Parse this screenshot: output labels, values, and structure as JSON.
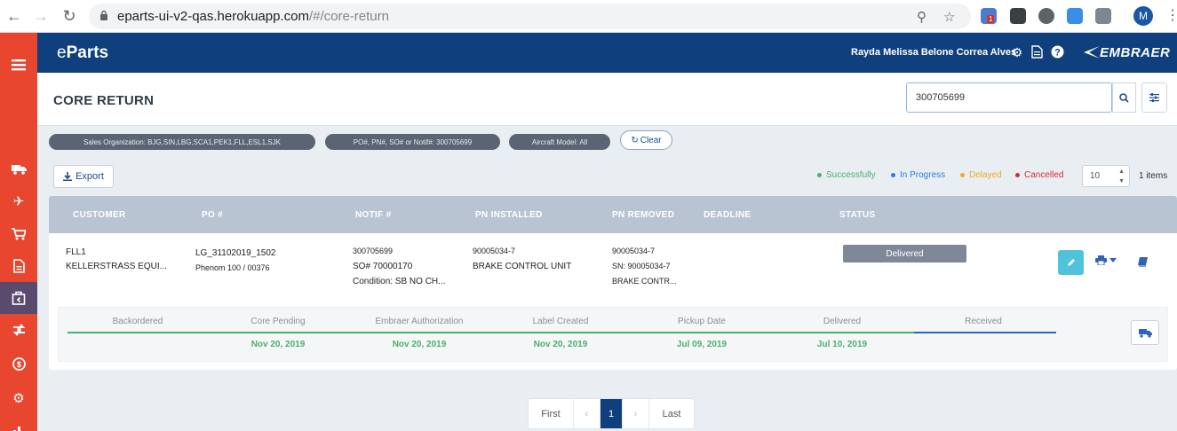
{
  "browser": {
    "url_host": "eparts-ui-v2-qas.herokuapp.com",
    "url_path": "/#/core-return",
    "profile_initial": "M",
    "ext_badge": "1"
  },
  "header": {
    "logo_e": "e",
    "logo_rest": "Parts",
    "user_name": "Rayda Melissa Belone Correa Alves",
    "brand": "EMBRAER"
  },
  "page": {
    "title": "CORE RETURN",
    "search_value": "300705699"
  },
  "filters": {
    "sales_org": "Sales Organization: BJG,SIN,LBG,SCA1,PEK1,FLL,ESL1,SJK",
    "po_filter": "PO#, PN#, SO# or Notif#: 300705699",
    "aircraft": "Aircraft Model: All",
    "clear_label": "Clear"
  },
  "toolbar": {
    "export_label": "Export",
    "per_page": "10",
    "items_count": "1 items"
  },
  "legend": [
    {
      "label": "Successfully",
      "color": "#4caf6a"
    },
    {
      "label": "In Progress",
      "color": "#2f7de0"
    },
    {
      "label": "Delayed",
      "color": "#f5a623"
    },
    {
      "label": "Cancelled",
      "color": "#d0312d"
    }
  ],
  "table": {
    "headers": [
      "CUSTOMER",
      "PO #",
      "NOTIF #",
      "PN INSTALLED",
      "PN REMOVED",
      "DEADLINE",
      "STATUS"
    ],
    "row": {
      "customer_code": "FLL1",
      "customer_name": "KELLERSTRASS EQUI...",
      "po": "LG_31102019_1502",
      "po_sub": "Phenom 100 / 00376",
      "notif": "300705699",
      "so": "SO# 70000170",
      "condition": "Condition: SB NO CH...",
      "pn_installed": "90005034-7",
      "pn_installed_desc": "BRAKE CONTROL UNIT",
      "pn_removed": "90005034-7",
      "pn_removed_sn": "SN: 90005034-7",
      "pn_removed_desc": "BRAKE CONTR...",
      "status": "Delivered"
    },
    "timeline": [
      {
        "label": "Backordered",
        "date": ""
      },
      {
        "label": "Core Pending",
        "date": "Nov 20, 2019"
      },
      {
        "label": "Embraer Authorization",
        "date": "Nov 20, 2019"
      },
      {
        "label": "Label Created",
        "date": "Nov 20, 2019"
      },
      {
        "label": "Pickup Date",
        "date": "Jul 09, 2019"
      },
      {
        "label": "Delivered",
        "date": "Jul 10, 2019"
      },
      {
        "label": "Received",
        "date": ""
      }
    ]
  },
  "pagination": {
    "first": "First",
    "prev": "‹",
    "current": "1",
    "next": "›",
    "last": "Last"
  }
}
